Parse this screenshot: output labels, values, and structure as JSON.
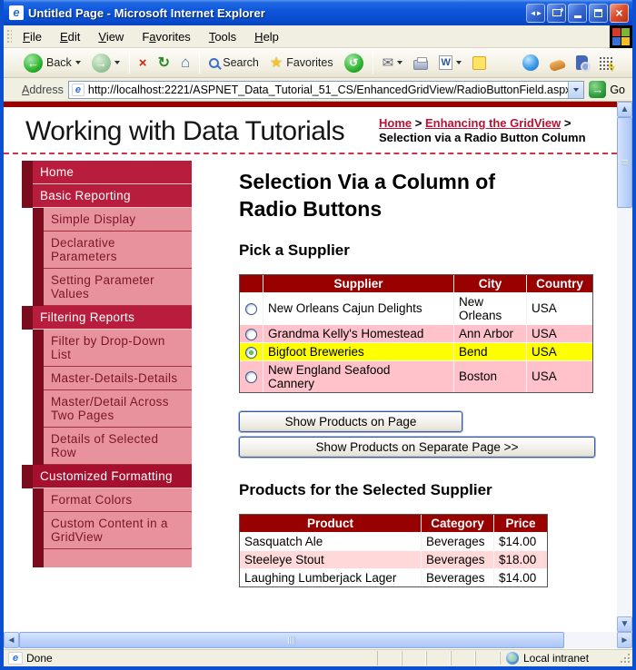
{
  "window": {
    "title": "Untitled Page - Microsoft Internet Explorer"
  },
  "menu": {
    "items": [
      {
        "label": "File",
        "accel": 0
      },
      {
        "label": "Edit",
        "accel": 0
      },
      {
        "label": "View",
        "accel": 0
      },
      {
        "label": "Favorites",
        "accel": 1
      },
      {
        "label": "Tools",
        "accel": 0
      },
      {
        "label": "Help",
        "accel": 0
      }
    ]
  },
  "toolbar": {
    "back": "Back",
    "search": "Search",
    "favorites": "Favorites"
  },
  "address": {
    "label": "Address",
    "url": "http://localhost:2221/ASPNET_Data_Tutorial_51_CS/EnhancedGridView/RadioButtonField.aspx",
    "go": "Go"
  },
  "header": {
    "site_title": "Working with Data Tutorials",
    "separator": ">",
    "breadcrumb": [
      {
        "label": "Home",
        "link": true
      },
      {
        "label": "Enhancing the GridView",
        "link": true
      },
      {
        "label": "Selection via a Radio Button Column",
        "link": false
      }
    ]
  },
  "sidebar": {
    "items": [
      {
        "label": "Home",
        "level": 1
      },
      {
        "label": "Basic Reporting",
        "level": 1
      },
      {
        "label": "Simple Display",
        "level": 2
      },
      {
        "label": "Declarative Parameters",
        "level": 2
      },
      {
        "label": "Setting Parameter Values",
        "level": 2
      },
      {
        "label": "Filtering Reports",
        "level": 1
      },
      {
        "label": "Filter by Drop-Down List",
        "level": 2
      },
      {
        "label": "Master-Details-Details",
        "level": 2
      },
      {
        "label": "Master/Detail Across Two Pages",
        "level": 2
      },
      {
        "label": "Details of Selected Row",
        "level": 2
      },
      {
        "label": "Customized Formatting",
        "level": 1,
        "current": true
      },
      {
        "label": "Format Colors",
        "level": 2
      },
      {
        "label": "Custom Content in a GridView",
        "level": 2
      }
    ]
  },
  "main": {
    "heading": "Selection Via a Column of\nRadio Buttons",
    "pick_supplier_heading": "Pick a Supplier",
    "supplier_table": {
      "headers": [
        "",
        "Supplier",
        "City",
        "Country"
      ],
      "rows": [
        {
          "supplier": "New Orleans Cajun Delights",
          "city": "New\nOrleans",
          "country": "USA",
          "selected": false,
          "style": "white"
        },
        {
          "supplier": "Grandma Kelly's Homestead",
          "city": "Ann Arbor",
          "country": "USA",
          "selected": false,
          "style": "pink"
        },
        {
          "supplier": "Bigfoot Breweries",
          "city": "Bend",
          "country": "USA",
          "selected": true,
          "style": "selected"
        },
        {
          "supplier": "New England Seafood\nCannery",
          "city": "Boston",
          "country": "USA",
          "selected": false,
          "style": "pink"
        }
      ]
    },
    "buttons": {
      "show_on_page": "Show Products on Page",
      "show_separate": "Show Products on Separate Page >>"
    },
    "products_heading": "Products for the Selected Supplier",
    "products_table": {
      "headers": [
        "Product",
        "Category",
        "Price"
      ],
      "rows": [
        {
          "product": "Sasquatch Ale",
          "category": "Beverages",
          "price": "$14.00",
          "style": "white"
        },
        {
          "product": "Steeleye Stout",
          "category": "Beverages",
          "price": "$18.00",
          "style": "pink"
        },
        {
          "product": "Laughing Lumberjack Lager",
          "category": "Beverages",
          "price": "$14.00",
          "style": "white"
        }
      ]
    }
  },
  "statusbar": {
    "status": "Done",
    "zone": "Local intranet"
  },
  "colors": {
    "header_red": "#990000",
    "nav_crimson": "#b91d3d",
    "nav_dark": "#7a0c1e",
    "nav_pink": "#e8929e",
    "selected_yellow": "#ffff00",
    "row_pink": "#ffc2cb",
    "product_row_pink": "#ffd9d9",
    "link": "#bb1133"
  }
}
